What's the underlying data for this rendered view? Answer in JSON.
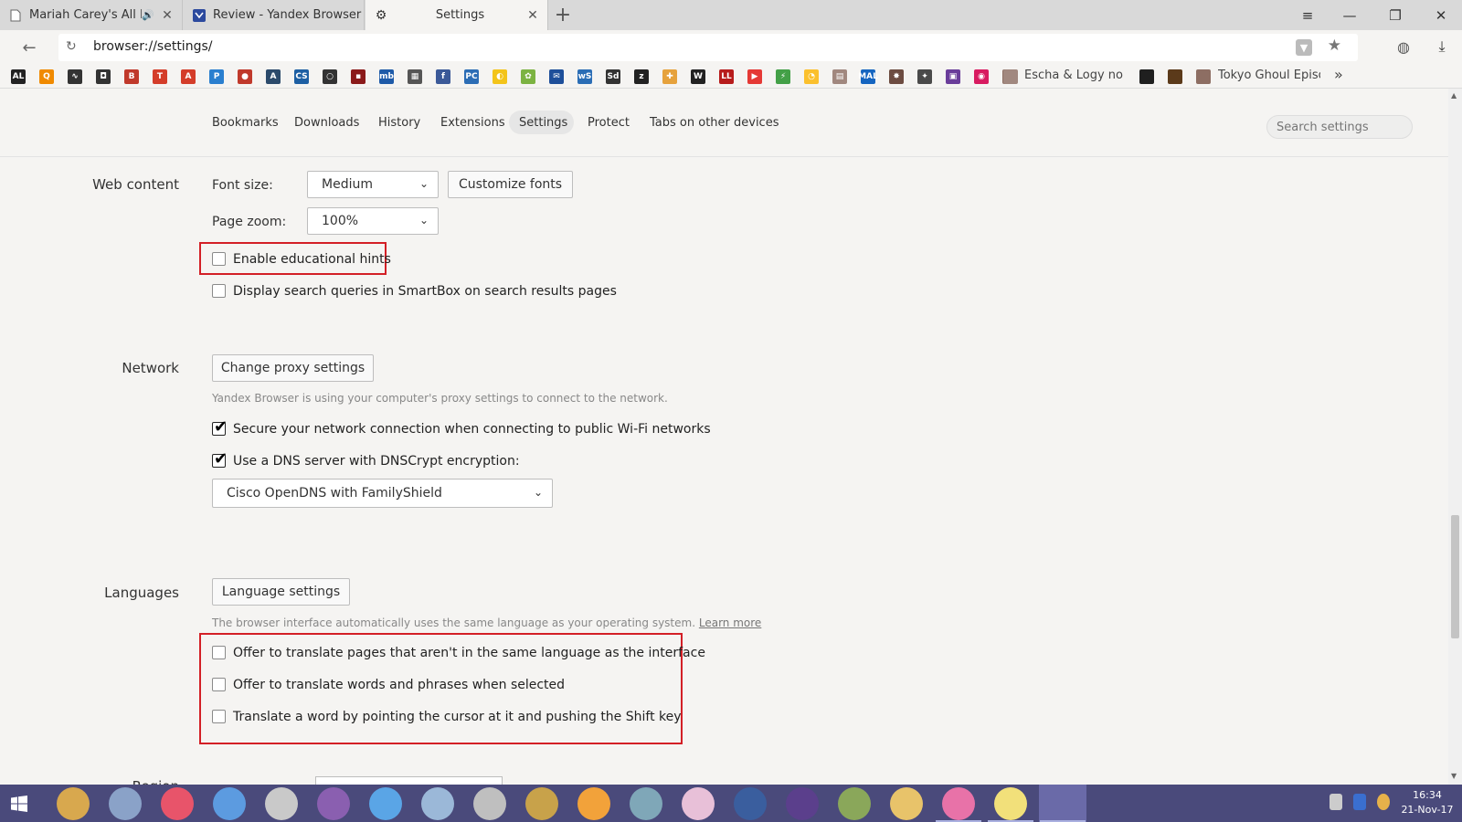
{
  "tabs": [
    {
      "label": "Mariah Carey's All I W...",
      "icon": "page-icon",
      "audio": true
    },
    {
      "label": "Review - Yandex Browser | Pa...",
      "icon": "yandex-icon"
    },
    {
      "label": "Settings",
      "icon": "gear-icon",
      "active": true
    }
  ],
  "window_controls": {
    "menu": "≡",
    "minimize": "—",
    "restore": "❐",
    "close": "✕"
  },
  "address": {
    "url": "browser://settings/"
  },
  "bookmarks": {
    "icons": [
      "AL",
      "Q",
      "∿",
      "◘",
      "B",
      "T",
      "A",
      "P",
      "●",
      "A",
      "CS",
      "○",
      "▪",
      "mb",
      "▦",
      "f",
      "PC",
      "◐",
      "✿",
      "✉",
      "wS",
      "Sd",
      "z",
      "✚",
      "W",
      "LL",
      "▶",
      "⚡",
      "◔",
      "▤",
      "MAL",
      "✸",
      "✦",
      "▣",
      "◉",
      "▦"
    ],
    "escha_label": "Escha & Logy no At",
    "tokyo_label": "Tokyo Ghoul Episo",
    "more": "»"
  },
  "nav": {
    "items": [
      "Bookmarks",
      "Downloads",
      "History",
      "Extensions",
      "Settings",
      "Protect",
      "Tabs on other devices"
    ],
    "search_placeholder": "Search settings"
  },
  "web_content": {
    "title": "Web content",
    "font_size_label": "Font size:",
    "font_size_value": "Medium",
    "customize_fonts": "Customize fonts",
    "page_zoom_label": "Page zoom:",
    "page_zoom_value": "100%",
    "educational_hints": "Enable educational hints",
    "smartbox_queries": "Display search queries in SmartBox on search results pages"
  },
  "network": {
    "title": "Network",
    "change_proxy": "Change proxy settings",
    "proxy_hint": "Yandex Browser is using your computer's proxy settings to connect to the network.",
    "secure_wifi": "Secure your network connection when connecting to public Wi-Fi networks",
    "dnscrypt": "Use a DNS server with DNSCrypt encryption:",
    "dns_value": "Cisco OpenDNS with FamilyShield"
  },
  "languages": {
    "title": "Languages",
    "language_settings": "Language settings",
    "hint": "The browser interface automatically uses the same language as your operating system.",
    "learn_more": "Learn more",
    "translate_pages": "Offer to translate pages that aren't in the same language as the interface",
    "translate_words": "Offer to translate words and phrases when selected",
    "translate_shift": "Translate a word by pointing the cursor at it and pushing the Shift key"
  },
  "region": {
    "title": "Region"
  },
  "taskbar": {
    "time": "16:34",
    "date": "21-Nov-17"
  }
}
